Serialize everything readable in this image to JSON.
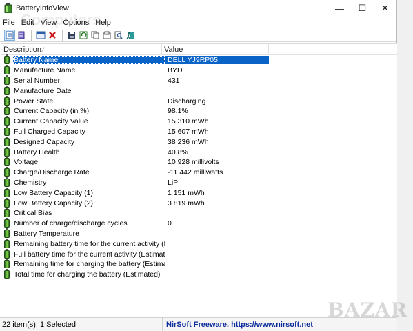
{
  "window": {
    "title": "BatteryInfoView",
    "controls": {
      "minimize": "—",
      "maximize": "☐",
      "close": "✕"
    }
  },
  "menu": [
    "File",
    "Edit",
    "View",
    "Options",
    "Help"
  ],
  "toolbar_icons": [
    "view-icon",
    "view2-icon",
    "properties-icon",
    "delete-icon",
    "save-icon",
    "refresh-icon",
    "copy-icon",
    "html-report-icon",
    "search-icon",
    "exit-icon"
  ],
  "list": {
    "columns": {
      "description": "Description",
      "value": "Value"
    },
    "rows": [
      {
        "description": "Battery Name",
        "value": "DELL YJ9RP05"
      },
      {
        "description": "Manufacture Name",
        "value": "BYD"
      },
      {
        "description": "Serial Number",
        "value": "431"
      },
      {
        "description": "Manufacture Date",
        "value": ""
      },
      {
        "description": "Power State",
        "value": "Discharging"
      },
      {
        "description": "Current Capacity (in %)",
        "value": "98.1%"
      },
      {
        "description": "Current Capacity Value",
        "value": "15 310 mWh"
      },
      {
        "description": "Full Charged Capacity",
        "value": "15 607 mWh"
      },
      {
        "description": "Designed Capacity",
        "value": "38 236 mWh"
      },
      {
        "description": "Battery Health",
        "value": "40.8%"
      },
      {
        "description": "Voltage",
        "value": "10 928 millivolts"
      },
      {
        "description": "Charge/Discharge Rate",
        "value": "-11 442 milliwatts"
      },
      {
        "description": "Chemistry",
        "value": "LiP"
      },
      {
        "description": "Low Battery Capacity (1)",
        "value": "1 151 mWh"
      },
      {
        "description": "Low Battery Capacity (2)",
        "value": "3 819 mWh"
      },
      {
        "description": "Critical Bias",
        "value": ""
      },
      {
        "description": "Number of charge/discharge cycles",
        "value": "0"
      },
      {
        "description": "Battery Temperature",
        "value": ""
      },
      {
        "description": "Remaining battery time for the current activity (Est...",
        "value": ""
      },
      {
        "description": "Full battery time for the current activity (Estimated)",
        "value": ""
      },
      {
        "description": "Remaining time for charging the battery (Estimated)",
        "value": ""
      },
      {
        "description": "Total  time for charging the battery (Estimated)",
        "value": ""
      }
    ],
    "selected_index": 0
  },
  "status": {
    "count": "22 item(s), 1 Selected",
    "link": "NirSoft Freeware. https://www.nirsoft.net"
  },
  "watermark": "BAZAR",
  "colors": {
    "selection": "#0a64c8",
    "link": "#0b2c9c",
    "battery_green": "#7fcf4a"
  }
}
